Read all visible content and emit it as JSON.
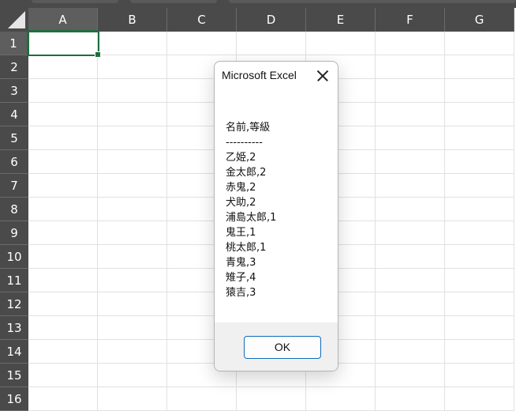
{
  "spreadsheet": {
    "columns": [
      "A",
      "B",
      "C",
      "D",
      "E",
      "F",
      "G"
    ],
    "rows": [
      "1",
      "2",
      "3",
      "4",
      "5",
      "6",
      "7",
      "8",
      "9",
      "10",
      "11",
      "12",
      "13",
      "14",
      "15",
      "16"
    ],
    "selected_column": "A",
    "selected_row": "1"
  },
  "dialog": {
    "title": "Microsoft Excel",
    "lines": [
      "名前,等級",
      "----------",
      "乙姫,2",
      "金太郎,2",
      "赤鬼,2",
      "犬助,2",
      "浦島太郎,1",
      "鬼王,1",
      "桃太郎,1",
      "青鬼,3",
      "雉子,4",
      "猿吉,3"
    ],
    "ok_label": "OK"
  },
  "colors": {
    "header_bg": "#4a4a4a",
    "selection": "#1e6e3d",
    "button_border": "#0f6cbd"
  }
}
